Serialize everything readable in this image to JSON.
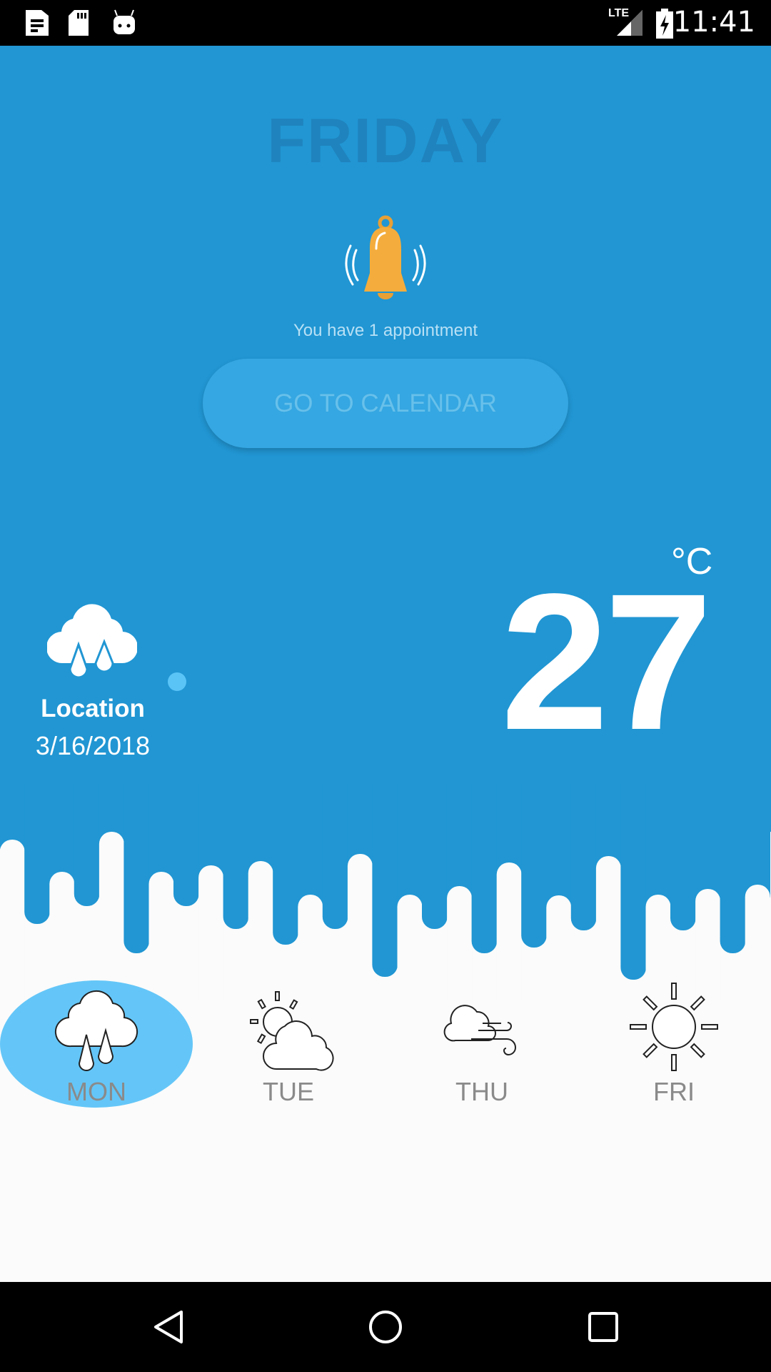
{
  "status_bar": {
    "time": "11:41",
    "network": "LTE"
  },
  "header": {
    "day_title": "FRIDAY"
  },
  "notification": {
    "text": "You have 1 appointment",
    "button_label": "GO TO CALENDAR"
  },
  "weather": {
    "temperature": "27",
    "unit": "°C",
    "location": "Location",
    "date": "3/16/2018",
    "icon": "rain-cloud-icon"
  },
  "forecast": [
    {
      "day": "MON",
      "icon": "rain-cloud-icon",
      "selected": true
    },
    {
      "day": "TUE",
      "icon": "partly-cloudy-icon",
      "selected": false
    },
    {
      "day": "THU",
      "icon": "windy-cloud-icon",
      "selected": false
    },
    {
      "day": "FRI",
      "icon": "sun-icon",
      "selected": false
    }
  ],
  "colors": {
    "primary": "#2196d3",
    "selected": "#64c6f8",
    "bell": "#f4ad3d"
  }
}
